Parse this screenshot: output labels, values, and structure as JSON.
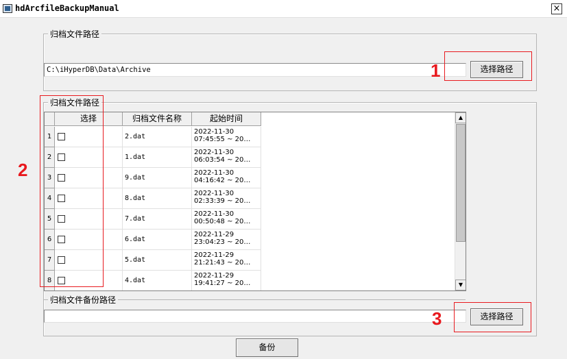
{
  "window": {
    "title": "hdArcfileBackupManual",
    "close_symbol": "×"
  },
  "archive_path_group": {
    "legend": "归档文件路径",
    "path_value": "C:\\iHyperDB\\Data\\Archive",
    "button_label": "选择路径"
  },
  "archive_list_group": {
    "legend": "归档文件路径",
    "columns": [
      "选择",
      "归档文件名称",
      "起始时间"
    ],
    "rows": [
      {
        "num": "1",
        "name": "2.dat",
        "t1": "2022-11-30",
        "t2": "07:45:55 ~ 20…",
        "checked": false
      },
      {
        "num": "2",
        "name": "1.dat",
        "t1": "2022-11-30",
        "t2": "06:03:54 ~ 20…",
        "checked": false
      },
      {
        "num": "3",
        "name": "9.dat",
        "t1": "2022-11-30",
        "t2": "04:16:42 ~ 20…",
        "checked": false
      },
      {
        "num": "4",
        "name": "8.dat",
        "t1": "2022-11-30",
        "t2": "02:33:39 ~ 20…",
        "checked": false
      },
      {
        "num": "5",
        "name": "7.dat",
        "t1": "2022-11-30",
        "t2": "00:50:48 ~ 20…",
        "checked": false
      },
      {
        "num": "6",
        "name": "6.dat",
        "t1": "2022-11-29",
        "t2": "23:04:23 ~ 20…",
        "checked": false
      },
      {
        "num": "7",
        "name": "5.dat",
        "t1": "2022-11-29",
        "t2": "21:21:43 ~ 20…",
        "checked": false
      },
      {
        "num": "8",
        "name": "4.dat",
        "t1": "2022-11-29",
        "t2": "19:41:27 ~ 20…",
        "checked": false
      }
    ]
  },
  "backup_path_group": {
    "legend": "归档文件备份路径",
    "path_value": "",
    "button_label": "选择路径"
  },
  "backup_button_label": "备份",
  "annotations": {
    "label_1": "1",
    "label_2": "2",
    "label_3": "3",
    "color": "#e8191e"
  }
}
